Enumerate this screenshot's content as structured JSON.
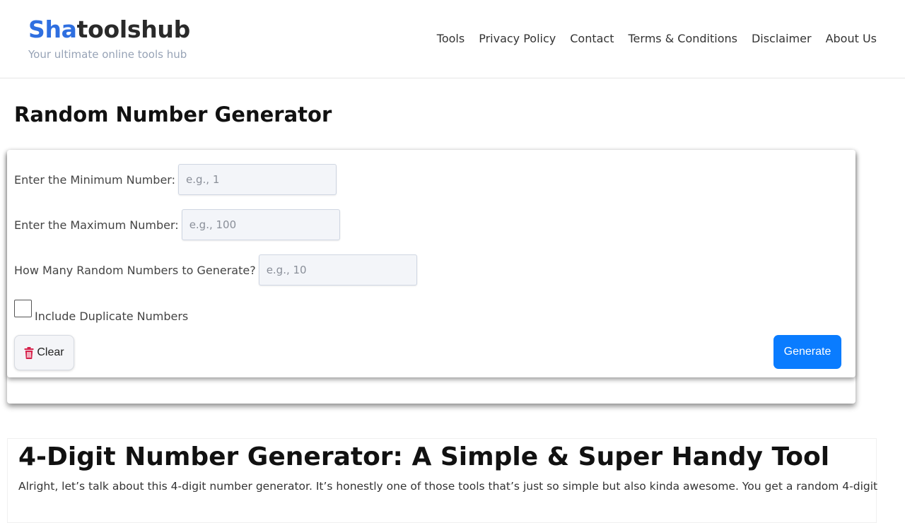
{
  "header": {
    "brand_accent": "Sha",
    "brand_rest": "toolshub",
    "tagline": "Your ultimate online tools hub",
    "nav": [
      "Tools",
      "Privacy Policy",
      "Contact",
      "Terms & Conditions",
      "Disclaimer",
      "About Us"
    ]
  },
  "page": {
    "title": "Random Number Generator"
  },
  "form": {
    "min_label": "Enter the Minimum Number:",
    "min_placeholder": "e.g., 1",
    "max_label": "Enter the Maximum Number:",
    "max_placeholder": "e.g., 100",
    "count_label": "How Many Random Numbers to Generate?",
    "count_placeholder": "e.g., 10",
    "duplicates_label": "Include Duplicate Numbers",
    "duplicates_checked": false,
    "clear_label": "Clear",
    "generate_label": "Generate"
  },
  "article": {
    "title": "4-Digit Number Generator: A Simple & Super Handy Tool",
    "intro": "Alright, let’s talk about this 4-digit number generator. It’s honestly one of those tools that’s just so simple but also kinda awesome. You get a random 4-digit"
  },
  "colors": {
    "brand_accent": "#2f6fe0",
    "generate_button": "#0a7cff",
    "trash_icon": "#d6204a"
  },
  "icons": {
    "clear": "trash-icon"
  }
}
